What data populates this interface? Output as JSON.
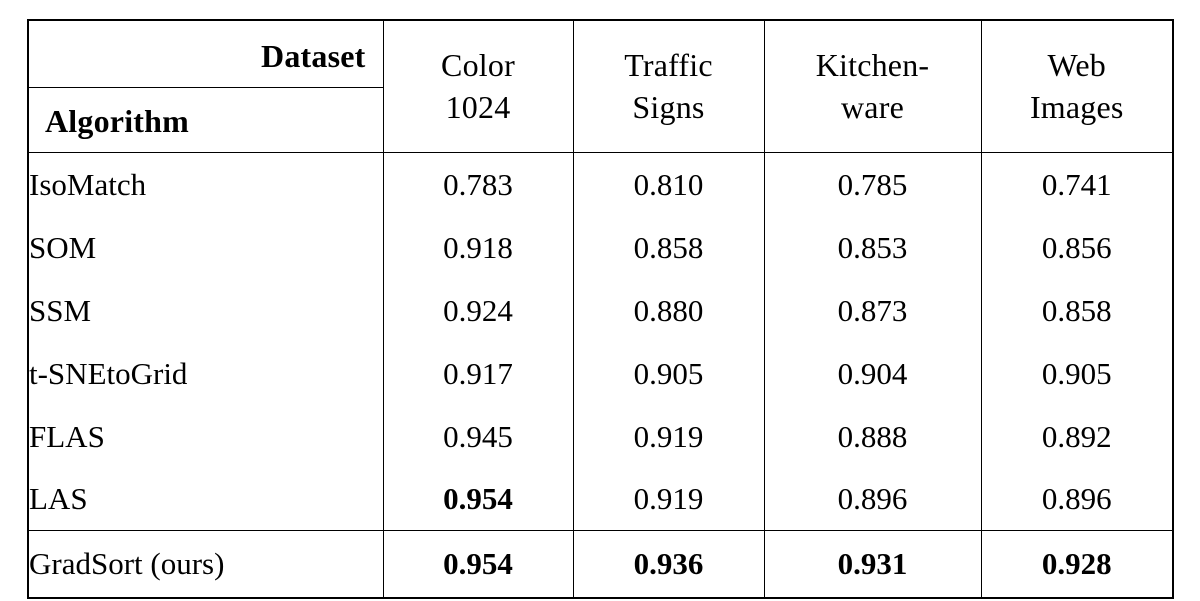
{
  "table": {
    "corner": {
      "dataset_label": "Dataset",
      "algorithm_label": "Algorithm"
    },
    "dataset_columns": [
      {
        "line1": "Color",
        "line2": "1024"
      },
      {
        "line1": "Traffic",
        "line2": "Signs"
      },
      {
        "line1": "Kitchen-",
        "line2": "ware"
      },
      {
        "line1": "Web",
        "line2": "Images"
      }
    ],
    "rows": [
      {
        "algorithm": "IsoMatch",
        "values": [
          "0.783",
          "0.810",
          "0.785",
          "0.741"
        ]
      },
      {
        "algorithm": "SOM",
        "values": [
          "0.918",
          "0.858",
          "0.853",
          "0.856"
        ]
      },
      {
        "algorithm": "SSM",
        "values": [
          "0.924",
          "0.880",
          "0.873",
          "0.858"
        ]
      },
      {
        "algorithm": "t-SNEtoGrid",
        "values": [
          "0.917",
          "0.905",
          "0.904",
          "0.905"
        ]
      },
      {
        "algorithm": "FLAS",
        "values": [
          "0.945",
          "0.919",
          "0.888",
          "0.892"
        ]
      },
      {
        "algorithm": "LAS",
        "values": [
          "0.954",
          "0.919",
          "0.896",
          "0.896"
        ]
      }
    ],
    "final_row": {
      "algorithm": "GradSort (ours)",
      "values": [
        "0.954",
        "0.936",
        "0.931",
        "0.928"
      ]
    },
    "colors": {
      "rule": "#000000",
      "text": "#000000",
      "background": "#ffffff"
    }
  }
}
